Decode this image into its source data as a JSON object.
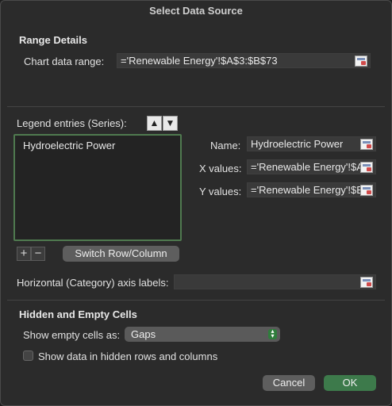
{
  "dialog": {
    "title": "Select Data Source"
  },
  "range_details": {
    "heading": "Range Details",
    "chart_range_label": "Chart data range:",
    "chart_range_value": "='Renewable Energy'!$A$3:$B$73"
  },
  "legend": {
    "label": "Legend entries (Series):",
    "up_icon": "arrow-up-icon",
    "down_icon": "arrow-down-icon",
    "items": [
      "Hydroelectric Power"
    ],
    "add_label": "+",
    "remove_label": "−",
    "switch_label": "Switch Row/Column"
  },
  "series": {
    "name_label": "Name:",
    "name_value": "Hydroelectric Power",
    "x_label": "X values:",
    "x_value": "='Renewable Energy'!$A",
    "y_label": "Y values:",
    "y_value": "='Renewable Energy'!$B"
  },
  "axis": {
    "label": "Horizontal (Category) axis labels:",
    "value": ""
  },
  "hidden": {
    "heading": "Hidden and Empty Cells",
    "show_empty_label": "Show empty cells as:",
    "show_empty_value": "Gaps",
    "show_hidden_label": "Show data in hidden rows and columns",
    "show_hidden_checked": false
  },
  "buttons": {
    "cancel": "Cancel",
    "ok": "OK"
  },
  "colors": {
    "accent": "#3d7a4b",
    "list_border": "#4f7a4f"
  }
}
